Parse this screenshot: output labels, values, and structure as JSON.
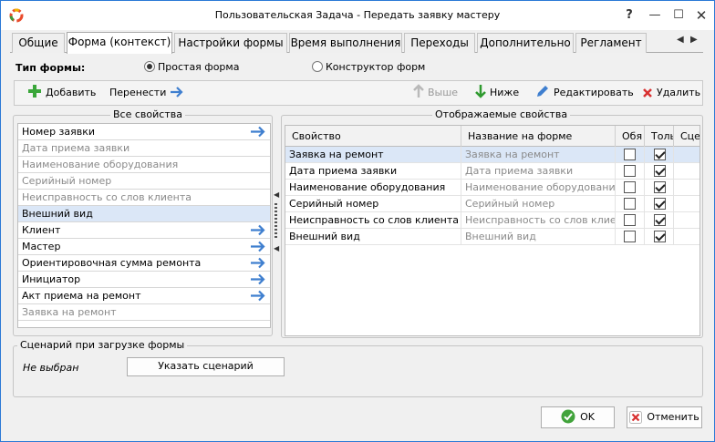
{
  "window": {
    "title": "Пользовательская Задача - Передать заявку мастеру"
  },
  "titlebar": {
    "help": "?",
    "minimize": "—",
    "maximize": "☐",
    "close": "✕"
  },
  "tabs": [
    {
      "label": "Общие"
    },
    {
      "label": "Форма (контекст)",
      "active": true
    },
    {
      "label": "Настройки формы"
    },
    {
      "label": "Время выполнения"
    },
    {
      "label": "Переходы"
    },
    {
      "label": "Дополнительно"
    },
    {
      "label": "Регламент"
    }
  ],
  "tab_scroll": {
    "left": "◀",
    "right": "▶"
  },
  "form_type": {
    "label": "Тип формы:",
    "options": [
      {
        "label": "Простая форма",
        "selected": true
      },
      {
        "label": "Конструктор форм",
        "selected": false
      }
    ]
  },
  "toolbar": {
    "add": "Добавить",
    "move": "Перенести",
    "up": "Выше",
    "down": "Ниже",
    "edit": "Редактировать",
    "delete": "Удалить"
  },
  "all_properties": {
    "title": "Все свойства",
    "items": [
      {
        "label": "Номер заявки",
        "state": "bold",
        "arrow": true
      },
      {
        "label": "Дата приема заявки",
        "state": "muted",
        "arrow": false
      },
      {
        "label": "Наименование оборудования",
        "state": "muted",
        "arrow": false
      },
      {
        "label": "Серийный номер",
        "state": "muted",
        "arrow": false
      },
      {
        "label": "Неисправность со слов клиента",
        "state": "muted",
        "arrow": false
      },
      {
        "label": "Внешний вид",
        "state": "selected",
        "arrow": false
      },
      {
        "label": "Клиент",
        "state": "bold",
        "arrow": true
      },
      {
        "label": "Мастер",
        "state": "bold",
        "arrow": true
      },
      {
        "label": "Ориентировочная сумма ремонта",
        "state": "bold",
        "arrow": true
      },
      {
        "label": "Инициатор",
        "state": "bold",
        "arrow": true
      },
      {
        "label": "Акт приема на ремонт",
        "state": "bold",
        "arrow": true
      },
      {
        "label": "Заявка на ремонт",
        "state": "muted",
        "arrow": false
      }
    ]
  },
  "displayed_properties": {
    "title": "Отображаемые свойства",
    "columns": [
      "Свойство",
      "Название на форме",
      "Обя",
      "Толь",
      "Сце"
    ],
    "rows": [
      {
        "property": "Заявка на ремонт",
        "form_name": "Заявка на ремонт",
        "required": false,
        "readonly": true,
        "selected": true
      },
      {
        "property": "Дата приема заявки",
        "form_name": "Дата приема заявки",
        "required": false,
        "readonly": true
      },
      {
        "property": "Наименование оборудования",
        "form_name": "Наименование оборудования",
        "required": false,
        "readonly": true
      },
      {
        "property": "Серийный номер",
        "form_name": "Серийный номер",
        "required": false,
        "readonly": true
      },
      {
        "property": "Неисправность со слов клиента",
        "form_name": "Неисправность со слов клие...",
        "required": false,
        "readonly": true
      },
      {
        "property": "Внешний вид",
        "form_name": "Внешний вид",
        "required": false,
        "readonly": true
      }
    ]
  },
  "script": {
    "title": "Сценарий при загрузке формы",
    "value": "Не выбран",
    "button": "Указать сценарий"
  },
  "buttons": {
    "ok": "OK",
    "cancel": "Отменить"
  },
  "colors": {
    "accent_blue": "#3f7fcf",
    "add_green": "#3aa63a",
    "down_green": "#2f9a2f",
    "delete_red": "#d83030",
    "ok_green": "#41a33b"
  }
}
